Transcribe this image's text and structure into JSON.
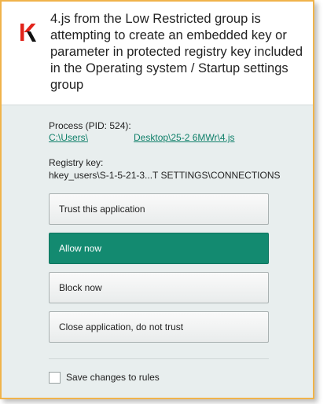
{
  "colors": {
    "window_border": "#f0b34a",
    "accent": "#138a70",
    "link": "#10806a",
    "logo_red": "#e2231a"
  },
  "header": {
    "logo_icon": "kaspersky-k-logo-icon",
    "message": "4.js from the Low Restricted group is attempting to create an embedded key or parameter in protected registry key included in the Operating system / Startup settings group"
  },
  "details": {
    "process_label": "Process (PID: 524):",
    "process_path_part1": "C:\\Users\\",
    "process_path_part2": "Desktop\\25-2 6MWr\\4.js",
    "registry_label": "Registry key:",
    "registry_value": "hkey_users\\S-1-5-21-3...T SETTINGS\\CONNECTIONS"
  },
  "actions": {
    "trust": "Trust this application",
    "allow": "Allow now",
    "block": "Block now",
    "close": "Close application, do not trust"
  },
  "options": {
    "save_rules_label": "Save changes to rules",
    "save_rules_checked": false
  }
}
